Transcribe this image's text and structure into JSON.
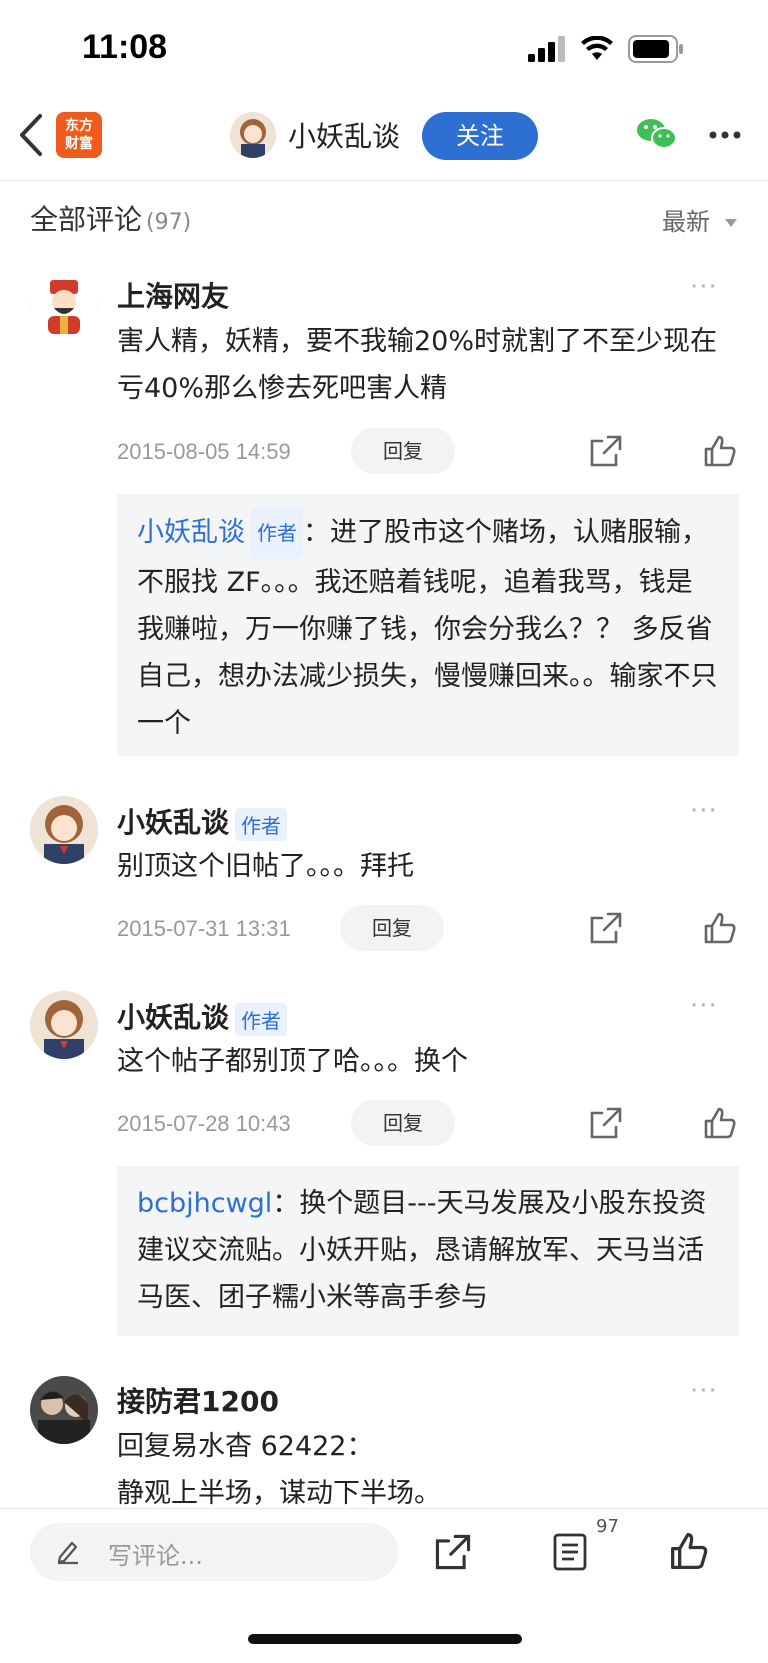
{
  "status": {
    "time": "11:08"
  },
  "header": {
    "logo_text_line1": "东方",
    "logo_text_line2": "财富",
    "title": "小妖乱谈",
    "follow_label": "关注"
  },
  "section": {
    "title": "全部评论",
    "count": "(97)",
    "sort_label": "最新"
  },
  "comments": [
    {
      "user": "上海网友",
      "text": "害人精，妖精，要不我输20%时就割了不至少现在亏40%那么惨去死吧害人精",
      "date": "2015-08-05 14:59",
      "reply_label": "回复",
      "quote": {
        "name": "小妖乱谈",
        "badge": "作者",
        "sep": "：",
        "text": "进了股市这个赌场，认赌服输，不服找 ZF。。。我还赔着钱呢，追着我骂，钱是我赚啦，万一你赚了钱，你会分我么？？ 多反省自己，想办法减少损失，慢慢赚回来。。输家不只一个"
      }
    },
    {
      "user": "小妖乱谈",
      "badge": "作者",
      "text": "别顶这个旧帖了。。。拜托",
      "date": "2015-07-31 13:31",
      "reply_label": "回复"
    },
    {
      "user": "小妖乱谈",
      "badge": "作者",
      "text": "这个帖子都别顶了哈。。。换个",
      "date": "2015-07-28 10:43",
      "reply_label": "回复",
      "quote": {
        "name": "bcbjhcwgl",
        "sep": "：",
        "text": "换个题目---天马发展及小股东投资建议交流贴。小妖开贴，恳请解放军、天马当活马医、团子糯小米等高手参与"
      }
    },
    {
      "user": "接防君1200",
      "text_line1": "回复易水杳 62422：",
      "text_line2": "静观上半场，谋动下半场。"
    }
  ],
  "more_label": "···",
  "bottom": {
    "placeholder": "写评论...",
    "comment_count": "97"
  }
}
